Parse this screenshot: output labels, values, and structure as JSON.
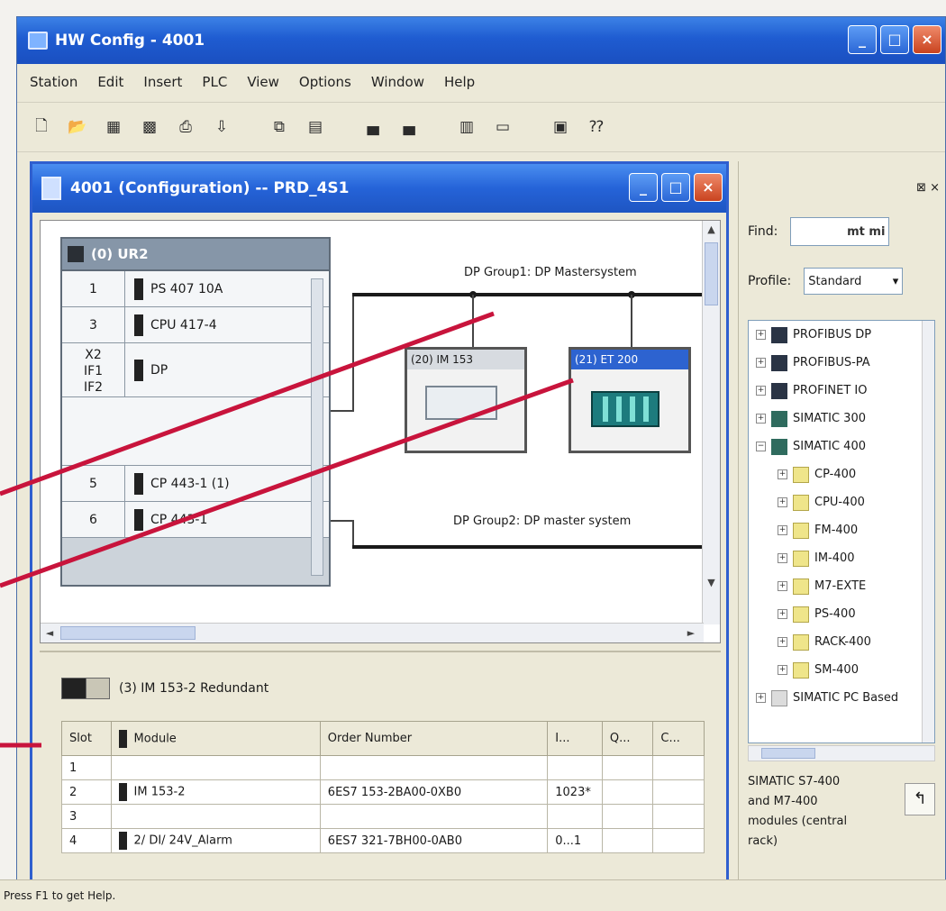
{
  "app": {
    "title": "HW Config - 4001",
    "window_buttons": {
      "minimize": "_",
      "maximize": "□",
      "close": "×"
    }
  },
  "menu": [
    "Station",
    "Edit",
    "Insert",
    "PLC",
    "View",
    "Options",
    "Window",
    "Help"
  ],
  "toolbar": {
    "icons": [
      "new-icon",
      "open-icon",
      "save-icon",
      "save-compile-icon",
      "print-icon",
      "download-icon",
      "upload-icon",
      "copy-icon",
      "paste-icon",
      "catalog-icon",
      "network-icon",
      "module-icon",
      "rack-icon",
      "monitor-icon",
      "help-icon"
    ]
  },
  "station_window": {
    "title": "4001 (Configuration) -- PRD_4S1"
  },
  "rack": {
    "name": "(0) UR2",
    "rows": [
      {
        "slot": "1",
        "module": "PS 407 10A"
      },
      {
        "slot": "3",
        "module": "CPU 417-4"
      },
      {
        "slot": "X2\nIF1\nIF2",
        "module": "DP"
      },
      {
        "slot": "5",
        "module": "CP 443-1 (1)"
      },
      {
        "slot": "6",
        "module": "CP 443-1"
      }
    ]
  },
  "network": {
    "dp_master_1": "DP Group1: DP Mastersystem",
    "dp_master_2": "DP Group2: DP master system",
    "slave_1_title": "(20) IM 153",
    "slave_2_title": "(21) ET 200"
  },
  "detail": {
    "caption": "(3) IM 153-2 Redundant",
    "columns": [
      "Slot",
      "Module",
      "Order Number",
      "I...",
      "Q...",
      "C..."
    ],
    "rows": [
      {
        "slot": "1",
        "module": "",
        "order": "",
        "i": "",
        "q": "",
        "c": ""
      },
      {
        "slot": "2",
        "module": "IM 153-2",
        "order": "6ES7 153-2BA00-0XB0",
        "i": "1023*",
        "q": "",
        "c": ""
      },
      {
        "slot": "3",
        "module": "",
        "order": "",
        "i": "",
        "q": "",
        "c": ""
      },
      {
        "slot": "4",
        "module": "2/ DI/ 24V_Alarm",
        "order": "6ES7 321-7BH00-0AB0",
        "i": "0...1",
        "q": "",
        "c": ""
      }
    ]
  },
  "catalog": {
    "close": "⊠ ×",
    "find_label": "Find:",
    "find_value": "mt mi",
    "profile_label": "Profile:",
    "profile_value": "Standard",
    "tree": [
      {
        "level": 0,
        "sign": "+",
        "icon": "net",
        "label": "PROFIBUS DP"
      },
      {
        "level": 0,
        "sign": "+",
        "icon": "net",
        "label": "PROFIBUS-PA"
      },
      {
        "level": 0,
        "sign": "+",
        "icon": "net",
        "label": "PROFINET IO"
      },
      {
        "level": 0,
        "sign": "+",
        "icon": "st",
        "label": "SIMATIC 300"
      },
      {
        "level": 0,
        "sign": "−",
        "icon": "st",
        "label": "SIMATIC 400"
      },
      {
        "level": 1,
        "sign": "+",
        "icon": "folder",
        "label": "CP-400"
      },
      {
        "level": 1,
        "sign": "+",
        "icon": "folder",
        "label": "CPU-400"
      },
      {
        "level": 1,
        "sign": "+",
        "icon": "folder",
        "label": "FM-400"
      },
      {
        "level": 1,
        "sign": "+",
        "icon": "folder",
        "label": "IM-400"
      },
      {
        "level": 1,
        "sign": "+",
        "icon": "folder",
        "label": "M7-EXTE"
      },
      {
        "level": 1,
        "sign": "+",
        "icon": "folder",
        "label": "PS-400"
      },
      {
        "level": 1,
        "sign": "+",
        "icon": "folder",
        "label": "RACK-400"
      },
      {
        "level": 1,
        "sign": "+",
        "icon": "folder",
        "label": "SM-400"
      },
      {
        "level": 0,
        "sign": "+",
        "icon": "sw",
        "label": "SIMATIC PC Based"
      }
    ],
    "info": "SIMATIC S7-400\nand M7-400\nmodules (central\nrack)"
  },
  "statusbar": "Press F1 to get Help."
}
